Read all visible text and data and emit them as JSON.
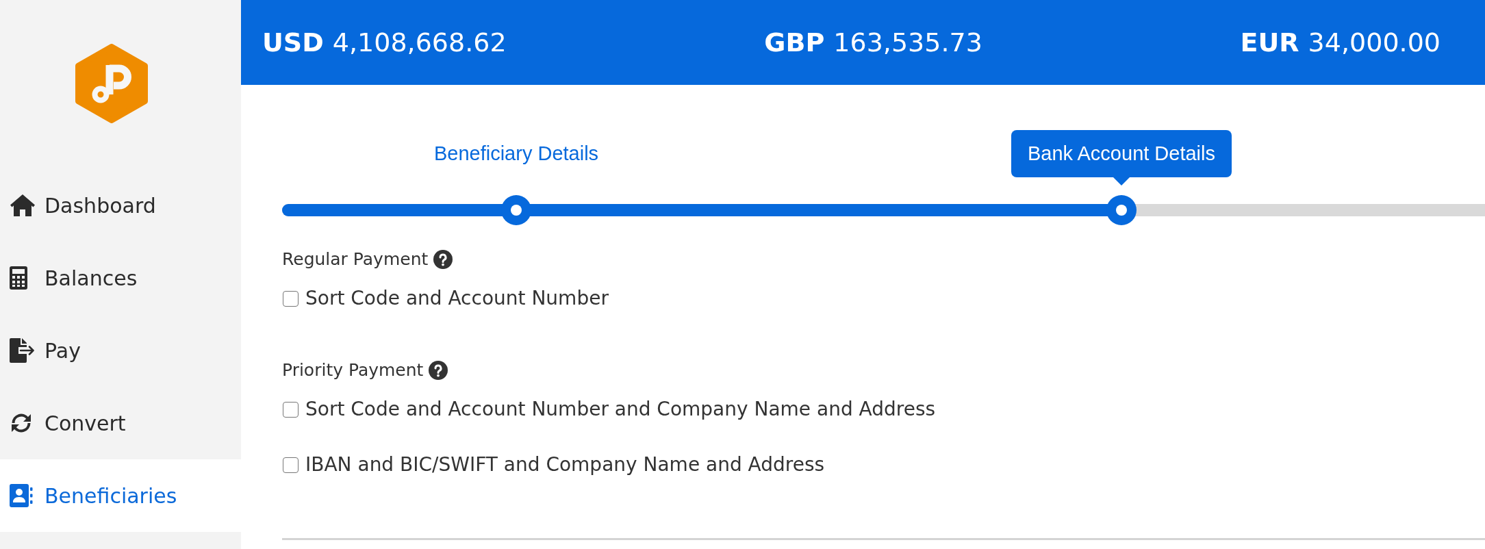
{
  "sidebar": {
    "items": [
      {
        "label": "Dashboard",
        "selected": false
      },
      {
        "label": "Balances",
        "selected": false
      },
      {
        "label": "Pay",
        "selected": false
      },
      {
        "label": "Convert",
        "selected": false
      },
      {
        "label": "Beneficiaries",
        "selected": true
      }
    ]
  },
  "balances": [
    {
      "currency": "USD",
      "amount": "4,108,668.62"
    },
    {
      "currency": "GBP",
      "amount": "163,535.73"
    },
    {
      "currency": "EUR",
      "amount": "34,000.00"
    }
  ],
  "stepper": {
    "steps": [
      {
        "label": "Beneficiary Details",
        "selected": false
      },
      {
        "label": "Bank Account Details",
        "selected": true
      }
    ],
    "level": 0.7
  },
  "sections": [
    {
      "title": "Regular Payment",
      "options": [
        {
          "label": "Sort Code and Account Number",
          "checked": false
        }
      ]
    },
    {
      "title": "Priority Payment",
      "options": [
        {
          "label": "Sort Code and Account Number and Company Name and Address",
          "checked": false
        },
        {
          "label": "IBAN and BIC/SWIFT and Company Name and Address",
          "checked": false
        }
      ]
    }
  ]
}
